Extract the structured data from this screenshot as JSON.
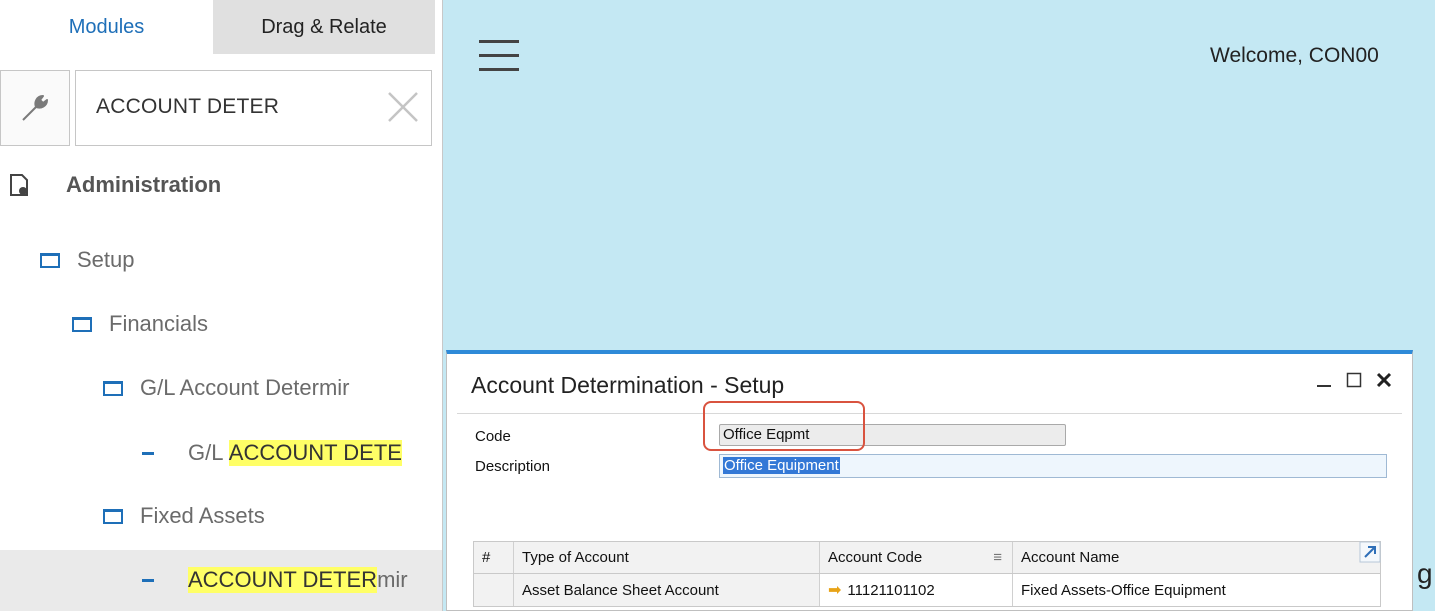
{
  "sidebar": {
    "tabs": {
      "modules": "Modules",
      "drag_relate": "Drag & Relate"
    },
    "search": {
      "value": "ACCOUNT DETER"
    },
    "tree": {
      "administration": "Administration",
      "setup": "Setup",
      "financials": "Financials",
      "gl_account_determination": "G/L Account Determir",
      "gl_prefix": "G/L ",
      "gl_highlight": "ACCOUNT DETE",
      "fixed_assets": "Fixed Assets",
      "ad_highlight": "ACCOUNT DETER",
      "ad_rest": "mir"
    }
  },
  "main": {
    "welcome": "Welcome, CON00",
    "bg_fragment": "g"
  },
  "dialog": {
    "title": "Account Determination - Setup",
    "code_label": "Code",
    "code_value": "Office Eqpmt",
    "description_label": "Description",
    "description_value": "Office Equipment",
    "grid": {
      "headers": {
        "num": "#",
        "type": "Type of Account",
        "code": "Account Code",
        "name": "Account Name"
      },
      "rows": [
        {
          "type": "Asset Balance Sheet Account",
          "code": "11121101102",
          "name": "Fixed Assets-Office Equipment"
        }
      ]
    }
  }
}
